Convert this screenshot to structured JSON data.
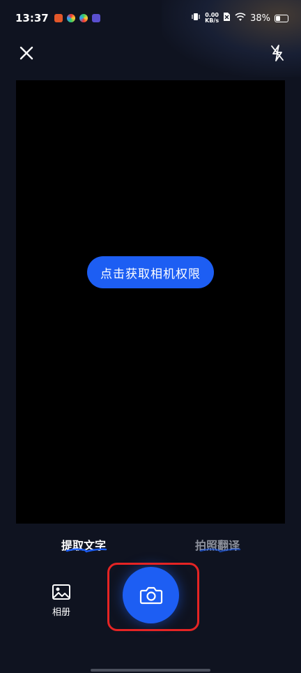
{
  "status_bar": {
    "time": "13:37",
    "net_speed_value": "0.00",
    "net_speed_unit": "KB/s",
    "battery": "38%",
    "battery_level": 0.38,
    "notification_icons": [
      "app-icon-orange",
      "colorful-app-icon",
      "colorful-app-icon-2",
      "video-app-icon"
    ]
  },
  "camera": {
    "permission_button": "点击获取相机权限"
  },
  "modes": {
    "active": "提取文字",
    "inactive": "拍照翻译"
  },
  "bottom": {
    "album_label": "相册"
  },
  "colors": {
    "accent": "#1d5ef3",
    "background": "#0f1320",
    "highlight": "#e52424"
  }
}
